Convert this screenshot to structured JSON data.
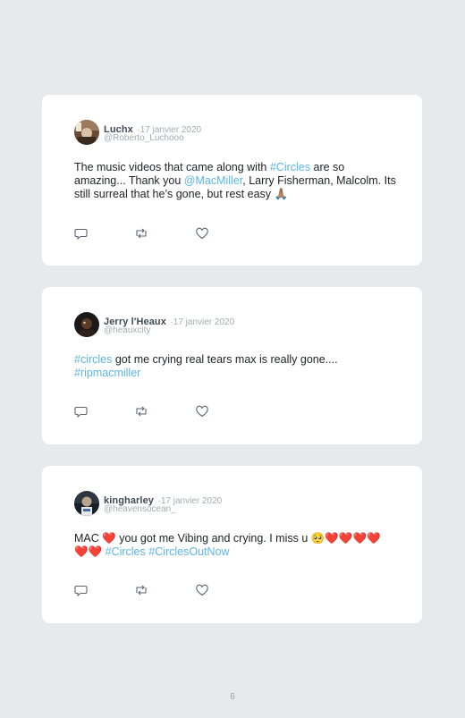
{
  "tweets": [
    {
      "name": "Luchx",
      "separator": "·",
      "date": "17 janvier 2020",
      "handle": "@Roberto_Luchooo",
      "text": [
        {
          "t": "The music videos that came along with "
        },
        {
          "t": "#Circles",
          "hl": true
        },
        {
          "t": " are so amazing... Thank you "
        },
        {
          "t": "@MacMiller",
          "hl": true
        },
        {
          "t": ", Larry Fisherman, Malcolm. Its still surreal that he’s gone, but rest easy 🙏🏽"
        }
      ]
    },
    {
      "name": "Jerry l'Heaux",
      "separator": "·",
      "date": "17 janvier 2020",
      "handle": "@heauxcity",
      "text": [
        {
          "t": "#circles",
          "hl": true
        },
        {
          "t": " got me crying real tears max is really gone.... "
        },
        {
          "t": "#ripmacmiller",
          "hl": true
        }
      ]
    },
    {
      "name": "kingharley",
      "separator": "·",
      "date": "17 janvier 2020",
      "handle": "@heavensocean_",
      "text": [
        {
          "t": "MAC ❤️ you got me Vibing and crying. I miss u 🥺❤️❤️❤️❤️ ❤️❤️ "
        },
        {
          "t": "#Circles",
          "hl": true
        },
        {
          "t": " "
        },
        {
          "t": "#CirclesOutNow",
          "hl": true
        }
      ]
    }
  ],
  "page_number": "6",
  "colors": {
    "background": "#e8e9eb",
    "card": "#ffffff",
    "link": "#5bb5e6",
    "muted": "#a3abb3"
  },
  "icons": [
    "reply-icon",
    "retweet-icon",
    "like-icon"
  ]
}
